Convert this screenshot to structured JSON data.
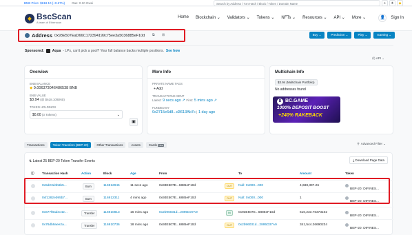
{
  "topbar": {
    "bnb_price": "BNB Price: $618.10 (+0.67%)",
    "gas": "Gas: 0.10 Gwei",
    "search_placeholder": "Search by Address / Txn Hash / Block / Token / Domain Name"
  },
  "logo": {
    "name": "BscScan",
    "sub": "A team of Etherscan"
  },
  "nav": {
    "items": [
      "Home",
      "Blockchain ⌄",
      "Validators ⌄",
      "Tokens ⌄",
      "NFTs ⌄",
      "Resources ⌄",
      "API ⌄",
      "More ⌄"
    ],
    "signin": "Sign In"
  },
  "address": {
    "label": "Address",
    "hash": "0x93E507EaD66C172394199c75ee3a5036885eF10d"
  },
  "actions": [
    "Buy ⌄",
    "Prediction ⌄",
    "Play ⌄",
    "Gaming ⌄"
  ],
  "sponsored": {
    "label": "Sponsored:",
    "brand": "Aqua",
    "text": "- LPs, can't pick a pool? Your full balance backs multiple positions.",
    "link": "See how"
  },
  "api_label": "API",
  "overview": {
    "title": "Overview",
    "bnb_balance_label": "BNB BALANCE",
    "bnb_balance": "0.006373046486538 BNB",
    "bnb_value_label": "BNB VALUE",
    "bnb_value": "$3.94",
    "bnb_value_rate": "(@ $618.10/BNB)",
    "holdings_label": "TOKEN HOLDINGS",
    "holdings": "$0.00",
    "holdings_tokens": "(3 Tokens)"
  },
  "more_info": {
    "title": "More Info",
    "tags_label": "PRIVATE NAME TAGS",
    "add": "+ Add",
    "tx_sent_label": "TRANSACTIONS SENT",
    "latest_prefix": "Latest:",
    "latest": "9 secs ago ↗",
    "first_prefix": "First:",
    "first": "5 mins ago ↗",
    "funded_label": "FUNDED BY",
    "funded_addr": "0x2715e6d8...d3613Ab7c",
    "funded_time": "1 day ago"
  },
  "multichain": {
    "title": "Multichain Info",
    "badge": "$3.94 (Multichain Portfolio)",
    "text": "No addresses found"
  },
  "ad": {
    "brand": "BC.GAME",
    "line1": "1000% DEPOSIT BOOST",
    "line2": "+240% RAKEBACK"
  },
  "tabs": [
    "Transactions",
    "Token Transfers (BEP-20)",
    "Other Transactions",
    "Assets",
    "Cards"
  ],
  "tab_new": "New",
  "advanced_filter": "Advanced Filter ⌄",
  "table": {
    "summary": "Latest 25 BEP-20 Token Transfer Events",
    "download": "Download Page Data",
    "columns": [
      "Transaction Hash",
      "Action",
      "Block",
      "Age",
      "From",
      "To",
      "Amount",
      "Token"
    ],
    "rows": [
      {
        "hash": "0x5d23d4b6b5...",
        "action": "Burn",
        "block": "116912945",
        "age": "11 secs ago",
        "from": "0x93E507E...6885eF10d",
        "dir": "OUT",
        "to": "Null: 0x000...000",
        "amount": "4,688,397.26",
        "token": "BEP-20: DIFINES..."
      },
      {
        "hash": "0xf1282eb95b7...",
        "action": "Burn",
        "block": "116912311",
        "age": "4 mins ago",
        "from": "0x93E507E...6885eF10d",
        "dir": "OUT",
        "to": "Null: 0x000...000",
        "amount": "1",
        "token": "BEP-20: DIFINES..."
      },
      {
        "hash": "0x677f8ad4c42...",
        "action": "Transfer",
        "block": "116910813",
        "age": "16 mins ago",
        "from": "0x2b96031d...2895D37A9",
        "dir": "IN",
        "to": "0x93E507E...6885eF10d",
        "amount": "610,233.76373102",
        "token": "BEP-20: DIFINES..."
      },
      {
        "hash": "0x76db9aee2a...",
        "action": "Transfer",
        "block": "116910736",
        "age": "18 mins ago",
        "from": "0x93E507E...6885eF10d",
        "dir": "OUT",
        "to": "0x2b96031d...2895D37A9",
        "amount": "341,544.26690234",
        "token": "BEP-20: DIFINES..."
      }
    ]
  }
}
